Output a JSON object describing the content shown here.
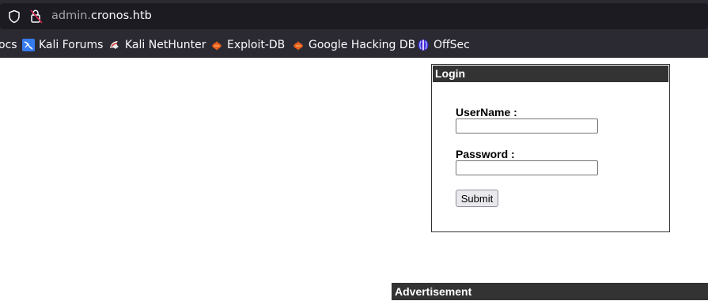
{
  "browser": {
    "url_subdomain": "admin.",
    "url_domain": "cronos.htb",
    "icons": {
      "tracking_protection": "shield-icon",
      "connection": "lock-icon"
    },
    "bookmarks": [
      {
        "label": "ocs",
        "icon": ""
      },
      {
        "label": "Kali Forums",
        "icon": "kali-forums-icon"
      },
      {
        "label": "Kali NetHunter",
        "icon": "kali-nethunter-icon"
      },
      {
        "label": "Exploit-DB",
        "icon": "exploit-db-icon"
      },
      {
        "label": "Google Hacking DB",
        "icon": "google-hacking-db-icon"
      },
      {
        "label": "OffSec",
        "icon": "offsec-icon"
      }
    ]
  },
  "login": {
    "title": "Login",
    "username_label": "UserName :",
    "username_value": "",
    "password_label": "Password :",
    "password_value": "",
    "submit_label": "Submit"
  },
  "advertisement": {
    "title": "Advertisement"
  },
  "colors": {
    "chrome_bg": "#2b2a33",
    "urlbar_bg": "#1c1b22",
    "box_header_bg": "#333333",
    "lock_strike": "#e22850"
  }
}
